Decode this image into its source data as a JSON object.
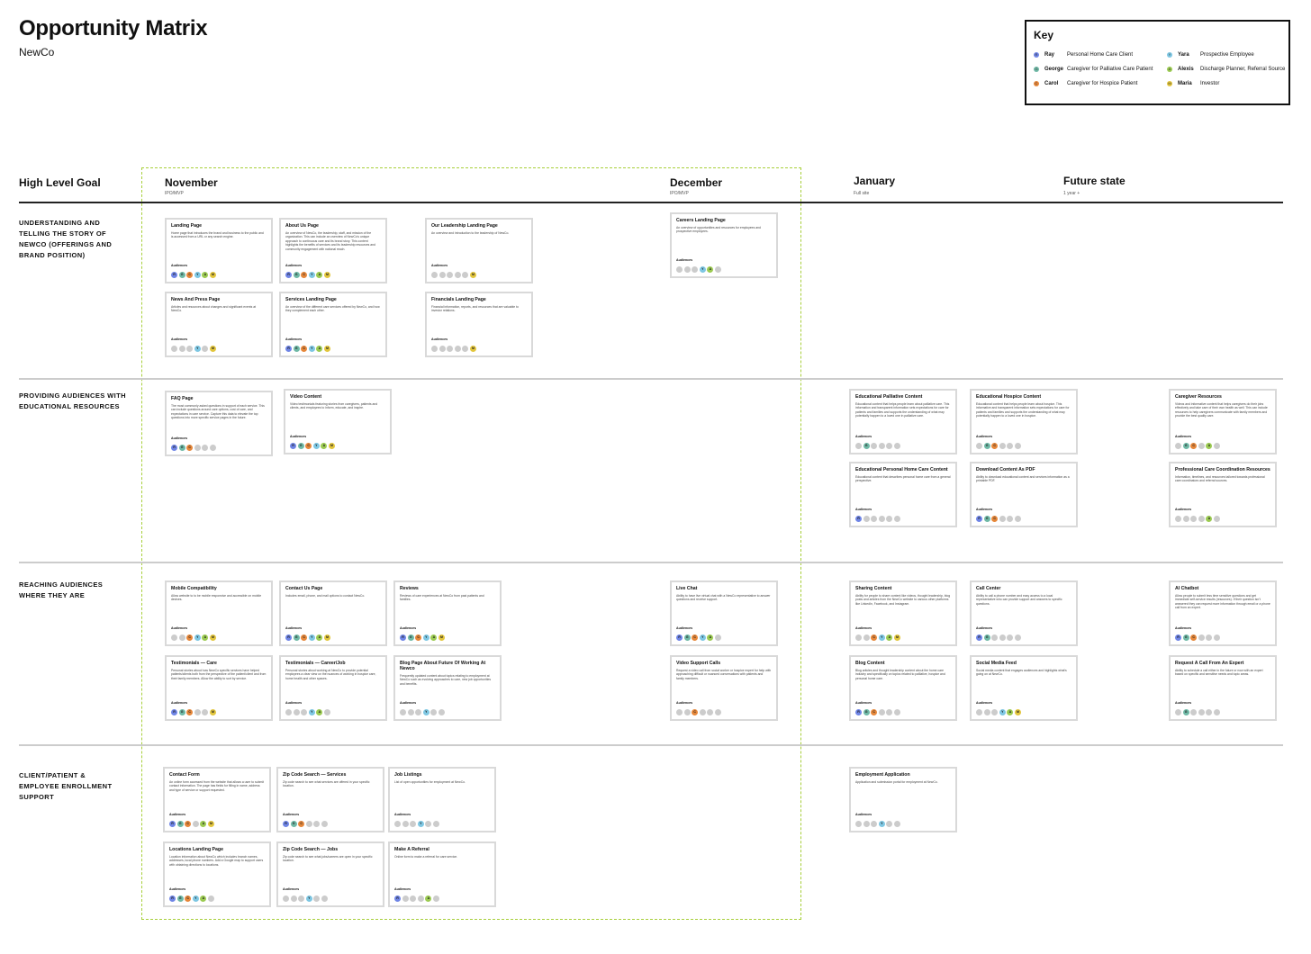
{
  "title": "Opportunity Matrix",
  "subtitle": "NewCo",
  "key": {
    "title": "Key",
    "entries": [
      {
        "letter": "R",
        "name": "Ray",
        "desc": "Personal Home Care Client",
        "color": "#6f85e6"
      },
      {
        "letter": "G",
        "name": "George",
        "desc": "Caregiver for Palliative Care Patient",
        "color": "#6fb9a6"
      },
      {
        "letter": "C",
        "name": "Carol",
        "desc": "Caregiver for Hospice Patient",
        "color": "#e6873a"
      },
      {
        "letter": "Y",
        "name": "Yara",
        "desc": "Prospective Employee",
        "color": "#7ec7e3"
      },
      {
        "letter": "A",
        "name": "Alexis",
        "desc": "Discharge Planner, Referral Source",
        "color": "#9ccb52"
      },
      {
        "letter": "M",
        "name": "Maria",
        "desc": "Investor",
        "color": "#e3c63d"
      }
    ]
  },
  "inactive_color": "#cccccc",
  "mvp_border_color": "#a8cf3a",
  "audiences_label": "Audiences",
  "columns": {
    "goal": {
      "title": "High Level Goal"
    },
    "november": {
      "title": "November",
      "sub": "IPO/MVP"
    },
    "december": {
      "title": "December",
      "sub": "IPO/MVP"
    },
    "january": {
      "title": "January",
      "sub": "Full site"
    },
    "future": {
      "title": "Future state",
      "sub": "1 year +"
    }
  },
  "rows": [
    {
      "label": "Understanding and telling the story of NewCo (offerings and brand position)"
    },
    {
      "label": "Providing audiences with educational resources"
    },
    {
      "label": "Reaching audiences where they are"
    },
    {
      "label": "Client/patient & employee enrollment support"
    }
  ],
  "cards": [
    {
      "title": "Landing Page",
      "desc": "Home page that introduces the brand and business to the public and is accessed from a URL or any search engine.",
      "aud": "RGCYAM"
    },
    {
      "title": "About Us Page",
      "desc": "An overview of NewCo, the leadership, staff, and mission of the organization. This can include an overview of NewCo's unique approach to continuous care and its brand story. This content highlights the benefits of services and its leadership resources and community engagement with national reach.",
      "aud": "RGCYAM"
    },
    {
      "title": "Our Leadership Landing Page",
      "desc": "An overview and introduction to the leadership of NewCo.",
      "aud": "M"
    },
    {
      "title": "Careers Landing Page",
      "desc": "An overview of opportunities and resources for employees and prospective employees.",
      "aud": "YA"
    },
    {
      "title": "News And Press Page",
      "desc": "Articles and resources about changes and significant events at NewCo.",
      "aud": "YM"
    },
    {
      "title": "Services Landing Page",
      "desc": "An overview of the different care services offered by NewCo, and how they complement each other.",
      "aud": "RGCYAM"
    },
    {
      "title": "Financials Landing Page",
      "desc": "Financial information, reports, and resources that are valuable to investor relations.",
      "aud": "M"
    },
    {
      "title": "FAQ Page",
      "desc": "The most commonly asked questions in support of each service. This can include questions around care options, cost of care, and expectations in care service. Capture this data to elevate the top questions into more specific service pages in the future.",
      "aud": "RGC"
    },
    {
      "title": "Video Content",
      "desc": "Video testimonials featuring stories from caregivers, patients and clients, and employees to inform, educate, and inspire.",
      "aud": "RGCYAM"
    },
    {
      "title": "Educational Palliative Content",
      "desc": "Educational content that helps people learn about palliative care. This information and transparent information sets expectations for care for patients and families and supports the understanding of what may potentially happen to a loved one in palliative care.",
      "aud": "G"
    },
    {
      "title": "Educational Hospice Content",
      "desc": "Educational content that helps people learn about hospice. This informative and transparent information sets expectations for care for patients and families and supports the understanding of what may potentially happen to a loved one in hospice.",
      "aud": "GC"
    },
    {
      "title": "Caregiver Resources",
      "desc": "Videos and informative content that helps caregivers do their jobs effectively and take care of their own health as well. This can include resources to help caregivers communicate with family members and provide the best quality care.",
      "aud": "GCA"
    },
    {
      "title": "Educational Personal Home Care Content",
      "desc": "Educational content that describes personal home care from a general perspective.",
      "aud": "R"
    },
    {
      "title": "Download Content As PDF",
      "desc": "Ability to download educational content and services information as a printable PDF.",
      "aud": "RGC"
    },
    {
      "title": "Professional Care Coordination Resources",
      "desc": "Information, timelines, and resources tailored towards professional care coordinators and referral sources.",
      "aud": "A"
    },
    {
      "title": "Mobile Compatibility",
      "desc": "Allow website to to be mobile responsive and accessible on mobile devices.",
      "aud": "CYAM"
    },
    {
      "title": "Contact Us Page",
      "desc": "Includes email, phone, and mail options to contact NewCo.",
      "aud": "RGYCMA"
    },
    {
      "title": "Reviews",
      "desc": "Reviews of care experiences at NewCo from past patients and families.",
      "aud": "RGCYAM"
    },
    {
      "title": "Live Chat",
      "desc": "Ability to have live virtual chat with a NewCo representative to answer questions and receive support.",
      "aud": "RGCAY"
    },
    {
      "title": "Sharing Content",
      "desc": "Ability for people to share content like videos, thought leadership, blog posts and articles from the NewCo website to various other platforms like LinkedIn, Facebook, and Instagram.",
      "aud": "CYAM"
    },
    {
      "title": "Call Center",
      "desc": "Ability to call a phone number and easy access to a local representative who can provide support and answers to specific questions.",
      "aud": "RG"
    },
    {
      "title": "AI Chatbot",
      "desc": "Allow people to submit less time sensitive questions and get immediate self-service results (resources). If their question isn't answered they can request more information through email or a phone call from an expert.",
      "aud": "RGC"
    },
    {
      "title": "Testimonials — Care",
      "desc": "Personal stories about how NewCo specific services have helped patients/clients both from the perspective of the patient/client and from their family members. Allow the ability to sort by service.",
      "aud": "RGCM"
    },
    {
      "title": "Testimonials — Career/Job",
      "desc": "Personal stories about working at NewCo to provide potential employees a clear view on the nuances of working in hospice care, home health and other spaces.",
      "aud": "YA"
    },
    {
      "title": "Blog Page About Future Of Working At Newco",
      "desc": "Frequently updated content about topics relating to employment at NewCo such as evolving approaches to care, new job opportunities and benefits.",
      "aud": "Y"
    },
    {
      "title": "Video Support Calls",
      "desc": "Request a video call from social worker or hospice expert for help with approaching difficult or nuanced conversations with patients and family members.",
      "aud": "C"
    },
    {
      "title": "Blog Content",
      "desc": "Blog articles and thought leadership content about the home care industry and specifically on topics related to palliative, hospice and personal home care.",
      "aud": "RGC"
    },
    {
      "title": "Social Media Feed",
      "desc": "Social media content that engages audiences and highlights what's going on at NewCo.",
      "aud": "YAM"
    },
    {
      "title": "Request A Call From An Expert",
      "desc": "Ability to schedule a call either in the future or now with an expert based on specific and sensitive needs and topic areas.",
      "aud": "G"
    },
    {
      "title": "Contact Form",
      "desc": "An online form accessed from the website that allows a user to submit contact information. The page has fields for filling in name, address and type of service or support requested.",
      "aud": "RGCAM"
    },
    {
      "title": "Zip Code Search — Services",
      "desc": "Zip code search to see what services are offered in your specific location.",
      "aud": "RGC"
    },
    {
      "title": "Job Listings",
      "desc": "List of open opportunities for employment at NewCo.",
      "aud": "Y"
    },
    {
      "title": "Employment Application",
      "desc": "Application and submission portal for employment at NewCo.",
      "aud": "Y"
    },
    {
      "title": "Locations Landing Page",
      "desc": "Location information about NewCo which includes branch names, addresses, local phone numbers. Add a Google map to support users with obtaining directions to locations.",
      "aud": "RGCYA"
    },
    {
      "title": "Zip Code Search — Jobs",
      "desc": "Zip code search to see what jobs/careers are open in your specific location.",
      "aud": "Y"
    },
    {
      "title": "Make A Referral",
      "desc": "Online form to make a referral for care service.",
      "aud": "RA"
    }
  ]
}
